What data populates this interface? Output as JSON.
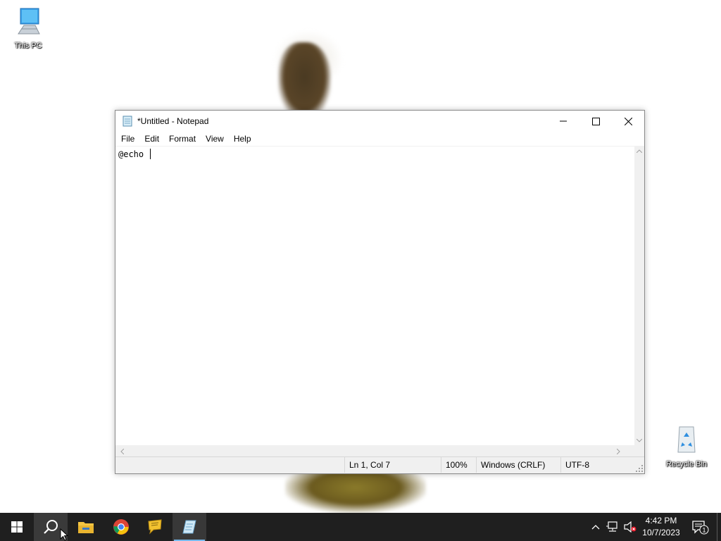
{
  "desktop": {
    "icons": [
      {
        "label": "This PC",
        "icon": "computer-icon"
      },
      {
        "label": "Recycle Bin",
        "icon": "recycle-bin-icon"
      }
    ]
  },
  "notepad": {
    "title": "*Untitled - Notepad",
    "menu": [
      "File",
      "Edit",
      "Format",
      "View",
      "Help"
    ],
    "content": "@echo ",
    "status": {
      "position": "Ln 1, Col 7",
      "zoom": "100%",
      "line_ending": "Windows (CRLF)",
      "encoding": "UTF-8"
    }
  },
  "taskbar": {
    "apps": [
      "start-icon",
      "search-icon",
      "file-explorer-icon",
      "chrome-icon",
      "sticky-chat-icon",
      "notepad-icon"
    ],
    "clock": {
      "time": "4:42 PM",
      "date": "10/7/2023"
    },
    "notification_count": "1"
  },
  "colors": {
    "taskbar_bg": "#1f1f1f",
    "accent": "#76b9ed"
  }
}
